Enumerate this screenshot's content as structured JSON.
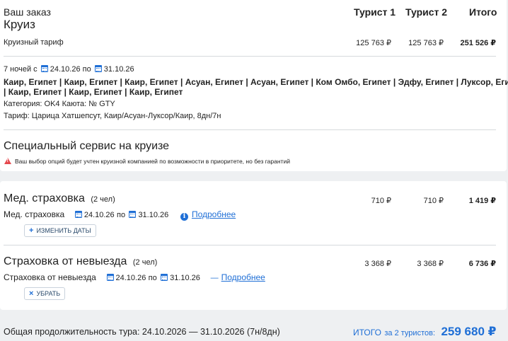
{
  "order": {
    "title": "Ваш заказ",
    "subtitle": "Круиз",
    "columns": [
      "Турист 1",
      "Турист 2",
      "Итого"
    ],
    "tariff_label": "Круизный тариф",
    "tariff_values": [
      "125 763 ₽",
      "125 763 ₽",
      "251 526 ₽"
    ],
    "nights": "7 ночей с",
    "date_from": "24.10.26",
    "date_to_prefix": "по",
    "date_to": "31.10.26",
    "route_line1": "Каир, Египет | Каир, Египет | Каир, Египет | Асуан, Египет | Асуан, Египет | Ком Омбо, Египет | Эдфу, Египет | Луксор, Египет",
    "route_line2": "| Каир, Египет | Каир, Египет | Каир, Египет",
    "category": "Категория: OK4  Каюта: № GTY",
    "tariff_name": "Тариф: Царица Хатшепсут, Каир/Асуан-Луксор/Каир, 8дн/7н"
  },
  "special": {
    "title": "Специальный сервис на круизе",
    "warning": "Ваш выбор опций будет учтен круизной компанией по возможности в приоритете, но без гарантий"
  },
  "insurance_med": {
    "title": "Мед. страховка",
    "persons": "(2 чел)",
    "values": [
      "710 ₽",
      "710 ₽",
      "1 419 ₽"
    ],
    "label": "Мед. страховка",
    "date_from": "24.10.26",
    "date_to_prefix": "по",
    "date_to": "31.10.26",
    "more": "Подробнее",
    "button": "ИЗМЕНИТЬ ДАТЫ"
  },
  "insurance_trip": {
    "title": "Страховка от невыезда",
    "persons": "(2 чел)",
    "values": [
      "3 368 ₽",
      "3 368 ₽",
      "6 736 ₽"
    ],
    "label": "Страховка от невыезда",
    "date_from": "24.10.26",
    "date_to_prefix": "по",
    "date_to": "31.10.26",
    "more": "Подробнее",
    "button": "УБРАТЬ"
  },
  "footer": {
    "duration": "Общая продолжительность тура: 24.10.2026 — 31.10.2026 (7н/8дн)",
    "total_label": "ИТОГО",
    "total_for": "за 2 туристов:",
    "total_value": "259 680 ₽"
  },
  "colors": {
    "accent": "#1f6fd6",
    "warning": "#e5484d",
    "background": "#eef0f2"
  }
}
